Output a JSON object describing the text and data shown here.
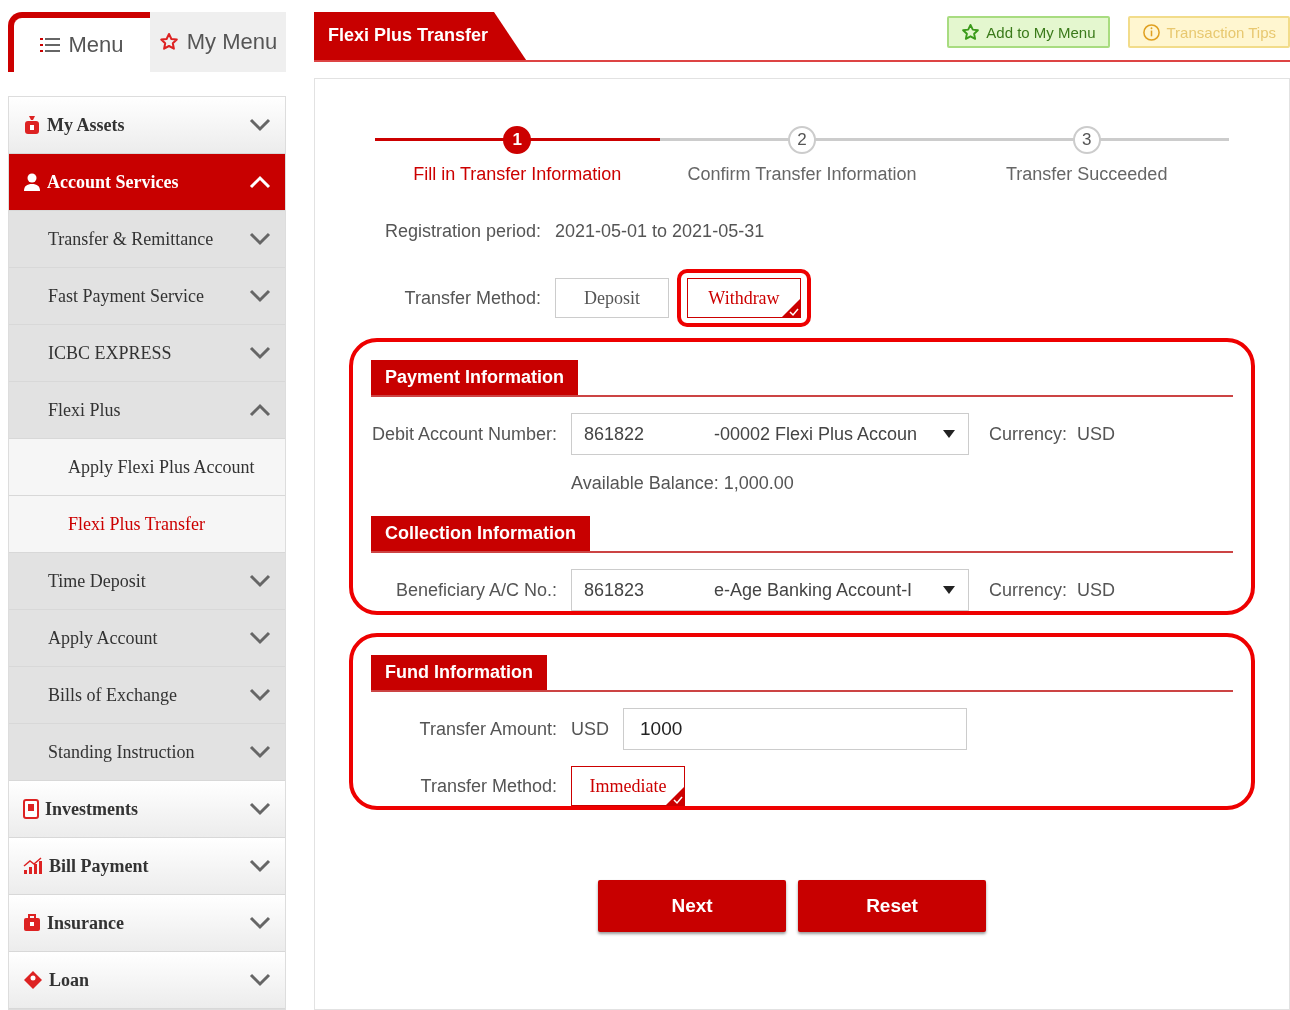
{
  "sidebar": {
    "tabs": [
      {
        "label": "Menu",
        "kind": "list",
        "selected": true
      },
      {
        "label": "My Menu",
        "kind": "star",
        "selected": false
      }
    ],
    "items": [
      {
        "label": "My Assets",
        "kind": "moneybag",
        "selected": false,
        "expanded": false
      },
      {
        "label": "Account Services",
        "kind": "person",
        "selected": true,
        "expanded": true,
        "children": [
          {
            "label": "Transfer & Remittance",
            "selected": false,
            "expanded": false
          },
          {
            "label": "Fast Payment Service",
            "selected": false,
            "expanded": false
          },
          {
            "label": "ICBC EXPRESS",
            "selected": false,
            "expanded": false
          },
          {
            "label": "Flexi Plus",
            "selected": false,
            "expanded": true,
            "children": [
              {
                "label": "Apply Flexi Plus Account",
                "selected": false
              },
              {
                "label": "Flexi Plus Transfer",
                "selected": true
              }
            ]
          },
          {
            "label": "Time Deposit",
            "selected": false,
            "expanded": false
          },
          {
            "label": "Apply Account",
            "selected": false,
            "expanded": false
          },
          {
            "label": "Bills of Exchange",
            "selected": false,
            "expanded": false
          },
          {
            "label": "Standing Instruction",
            "selected": false,
            "expanded": false
          }
        ]
      },
      {
        "label": "Investments",
        "kind": "document",
        "selected": false,
        "expanded": false
      },
      {
        "label": "Bill Payment",
        "kind": "chart",
        "selected": false,
        "expanded": false
      },
      {
        "label": "Insurance",
        "kind": "briefcase",
        "selected": false,
        "expanded": false
      },
      {
        "label": "Loan",
        "kind": "tag",
        "selected": false,
        "expanded": false
      }
    ]
  },
  "page_title": "Flexi Plus Transfer",
  "header_buttons": [
    {
      "label": "Add to My Menu",
      "kind": "add",
      "disabled": false
    },
    {
      "label": "Transaction Tips",
      "kind": "tips",
      "disabled": true
    }
  ],
  "steps": [
    {
      "number": "1",
      "label": "Fill in Transfer Information",
      "selected": true
    },
    {
      "number": "2",
      "label": "Confirm Transfer Information",
      "selected": false
    },
    {
      "number": "3",
      "label": "Transfer Succeeded",
      "selected": false
    }
  ],
  "registration": {
    "label": "Registration period:",
    "value": "2021-05-01 to 2021-05-31"
  },
  "transfer_method": {
    "label": "Transfer Method:",
    "highlighted": true,
    "options": [
      {
        "label": "Deposit",
        "selected": false
      },
      {
        "label": "Withdraw",
        "selected": true
      }
    ]
  },
  "groups": [
    {
      "highlighted": true,
      "sections": [
        {
          "title": "Payment Information",
          "rows": [
            {
              "kind": "select",
              "label": "Debit Account Number:",
              "account": "861822",
              "name": "-00002 Flexi Plus Accoun",
              "currency_label": "Currency:",
              "currency": "USD"
            },
            {
              "kind": "note",
              "text": "Available Balance: 1,000.00"
            }
          ]
        },
        {
          "title": "Collection Information",
          "rows": [
            {
              "kind": "select",
              "label": "Beneficiary A/C No.:",
              "account": "861823",
              "name": "e-Age Banking Account-I",
              "currency_label": "Currency:",
              "currency": "USD"
            }
          ]
        }
      ]
    },
    {
      "highlighted": true,
      "sections": [
        {
          "title": "Fund Information",
          "rows": [
            {
              "kind": "amount",
              "label": "Transfer Amount:",
              "currency": "USD",
              "value": "1000"
            },
            {
              "kind": "options",
              "label": "Transfer Method:",
              "options": [
                {
                  "label": "Immediate",
                  "selected": true
                }
              ]
            }
          ]
        }
      ]
    }
  ],
  "actions": [
    "Next",
    "Reset"
  ]
}
